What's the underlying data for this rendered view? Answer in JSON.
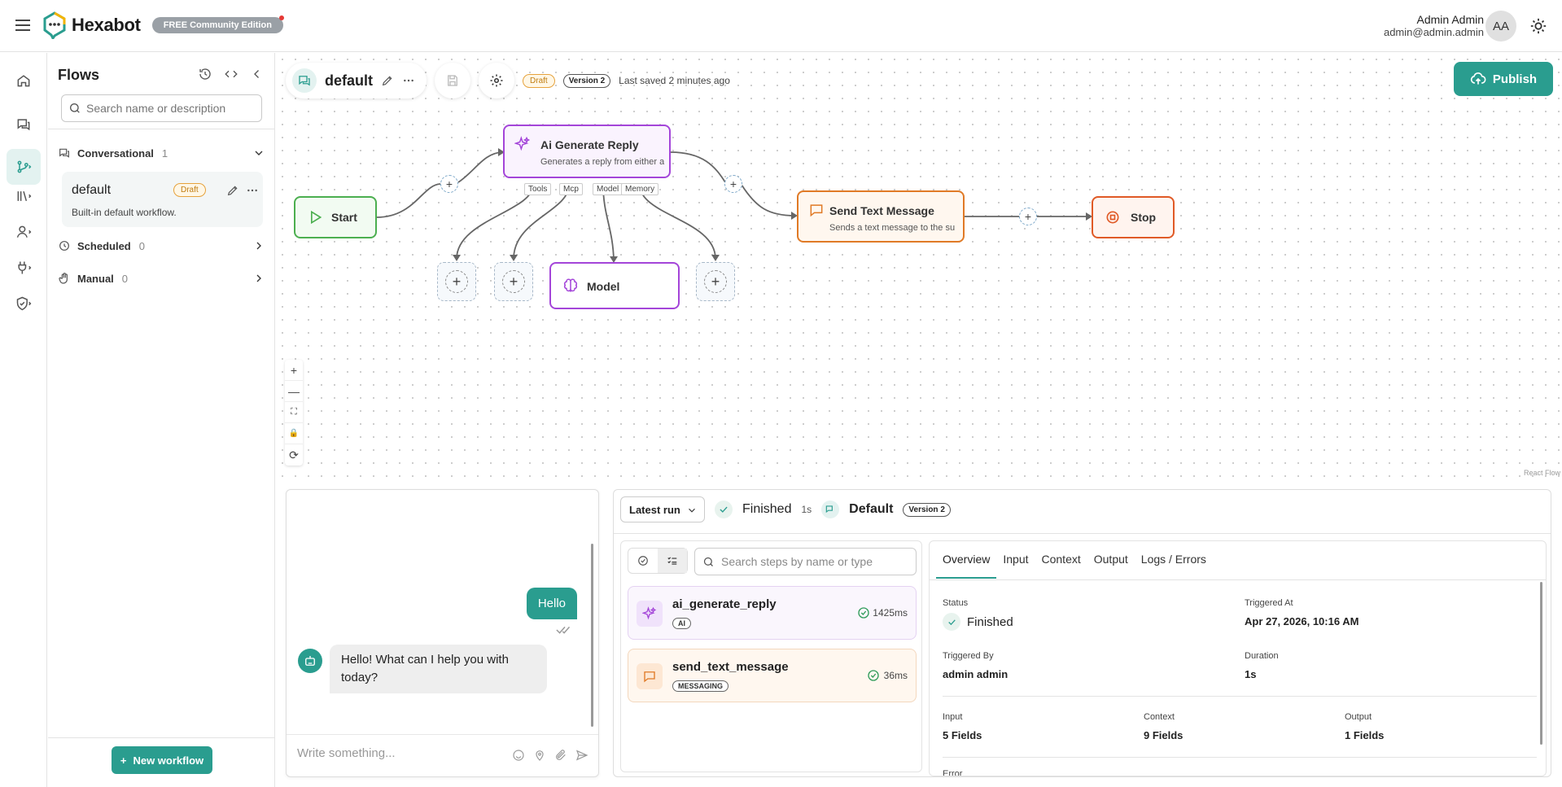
{
  "header": {
    "brand": "Hexabot",
    "edition": "FREE Community Edition",
    "user_name": "Admin Admin",
    "user_email": "admin@admin.admin",
    "avatar_initials": "AA"
  },
  "rail": {
    "items": [
      {
        "icon": "home-icon"
      },
      {
        "icon": "chat-icon"
      },
      {
        "icon": "flows-icon",
        "active": true
      },
      {
        "icon": "library-icon"
      },
      {
        "icon": "user-icon"
      },
      {
        "icon": "plug-icon"
      },
      {
        "icon": "shield-icon"
      }
    ]
  },
  "flows": {
    "title": "Flows",
    "search_placeholder": "Search name or description",
    "groups": [
      {
        "label": "Conversational",
        "count": "1",
        "expanded": true
      },
      {
        "label": "Scheduled",
        "count": "0",
        "expanded": false
      },
      {
        "label": "Manual",
        "count": "0",
        "expanded": false
      }
    ],
    "card": {
      "name": "default",
      "badge": "Draft",
      "description": "Built-in default workflow."
    },
    "new_workflow": "New workflow"
  },
  "toolbar": {
    "flow_name": "default",
    "draft_badge": "Draft",
    "version_badge": "Version 2",
    "saved_text": "Last saved 2 minutes ago",
    "publish_label": "Publish"
  },
  "nodes": {
    "start": {
      "title": "Start"
    },
    "ai": {
      "title": "Ai Generate Reply",
      "desc": "Generates a reply from either a di..."
    },
    "send": {
      "title": "Send Text Message",
      "desc": "Sends a text message to the sub..."
    },
    "stop": {
      "title": "Stop"
    },
    "model": {
      "title": "Model"
    },
    "ports": [
      "Tools",
      "Mcp",
      "Model",
      "Memory"
    ]
  },
  "canvas": {
    "zoom_controls": [
      "+",
      "—",
      "⛶",
      "🔒",
      "⟳"
    ],
    "attribution": "React Flow"
  },
  "chat": {
    "user_message": "Hello",
    "bot_message": "Hello! What can I help you with today?",
    "input_placeholder": "Write something..."
  },
  "run": {
    "select_label": "Latest run",
    "status": "Finished",
    "duration": "1s",
    "flow_name": "Default",
    "version_badge": "Version 2",
    "steps_search_placeholder": "Search steps by name or type",
    "steps": [
      {
        "name": "ai_generate_reply",
        "tag": "AI",
        "time": "1425ms"
      },
      {
        "name": "send_text_message",
        "tag": "MESSAGING",
        "time": "36ms"
      }
    ],
    "tabs": [
      "Overview",
      "Input",
      "Context",
      "Output",
      "Logs / Errors"
    ],
    "overview": {
      "status_label": "Status",
      "status_value": "Finished",
      "triggered_at_label": "Triggered At",
      "triggered_at_value": "Apr 27, 2026, 10:16 AM",
      "triggered_by_label": "Triggered By",
      "triggered_by_value": "admin admin",
      "duration_label": "Duration",
      "duration_value": "1s",
      "input_label": "Input",
      "input_value": "5 Fields",
      "context_label": "Context",
      "context_value": "9 Fields",
      "output_label": "Output",
      "output_value": "1 Fields",
      "error_label": "Error"
    }
  },
  "colors": {
    "accent": "#2a9d8f",
    "ai_border": "#a445d9",
    "message_border": "#e07a26",
    "start_border": "#4caf50",
    "stop_border": "#e05a26"
  }
}
